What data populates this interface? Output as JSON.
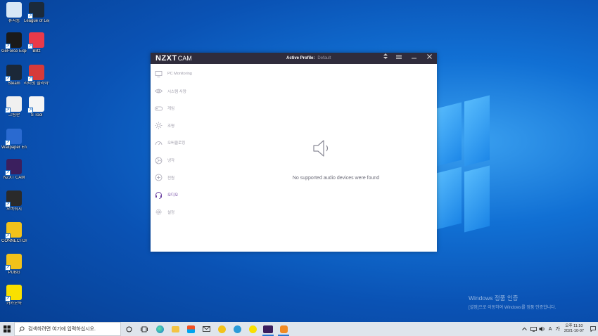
{
  "desktop": {
    "icons": [
      {
        "label": "휴지통",
        "color": "#d8e8f6"
      },
      {
        "label": "League of Legends",
        "color": "#1b2a3a"
      },
      {
        "label": "GeForce Experience",
        "color": "#1a1a1a"
      },
      {
        "label": "Blitz",
        "color": "#e83a4a"
      },
      {
        "label": "Steam",
        "color": "#1b2838"
      },
      {
        "label": "라이엇 클라이언트",
        "color": "#d63a3a"
      },
      {
        "label": "그림판",
        "color": "#f0f0f0"
      },
      {
        "label": "S Tool",
        "color": "#f5f5f5"
      },
      {
        "label": "Wallpaper Engine",
        "color": "#2a6ad0"
      },
      {
        "label": "NZXT CAM",
        "color": "#3b1f5e"
      },
      {
        "label": "오버워치",
        "color": "#2a2a2a"
      },
      {
        "label": "CONNECTORS",
        "color": "#f2c21a"
      },
      {
        "label": "PUBG",
        "color": "#f2c21a"
      },
      {
        "label": "카카오톡",
        "color": "#f9e000"
      }
    ]
  },
  "app": {
    "logo": "NZXT",
    "logo_suffix": "CAM",
    "profile_label": "Active Profile:",
    "profile_value": "Default",
    "nav": [
      {
        "label": "PC Monitoring",
        "icon": "monitor-icon"
      },
      {
        "label": "시스템 사양",
        "icon": "eye-icon"
      },
      {
        "label": "게임",
        "icon": "gamepad-icon"
      },
      {
        "label": "조명",
        "icon": "sun-icon"
      },
      {
        "label": "오버클로킹",
        "icon": "gauge-icon"
      },
      {
        "label": "냉각",
        "icon": "fan-icon"
      },
      {
        "label": "전원",
        "icon": "power-icon"
      },
      {
        "label": "오디오",
        "icon": "headset-icon",
        "active": true
      },
      {
        "label": "설정",
        "icon": "gear-icon"
      }
    ],
    "no_device_message": "No supported audio devices were found",
    "accent_color": "#6a3fa0"
  },
  "activation": {
    "title": "Windows 정품 인증",
    "subtitle": "[설정]으로 이동하여 Windows를 정품 인증합니다."
  },
  "taskbar": {
    "search_placeholder": "검색하려면 여기에 입력하십시오.",
    "clock_period": "오후 11:10",
    "clock_date": "2021-10-07",
    "ime": "A",
    "ime2": "가"
  }
}
